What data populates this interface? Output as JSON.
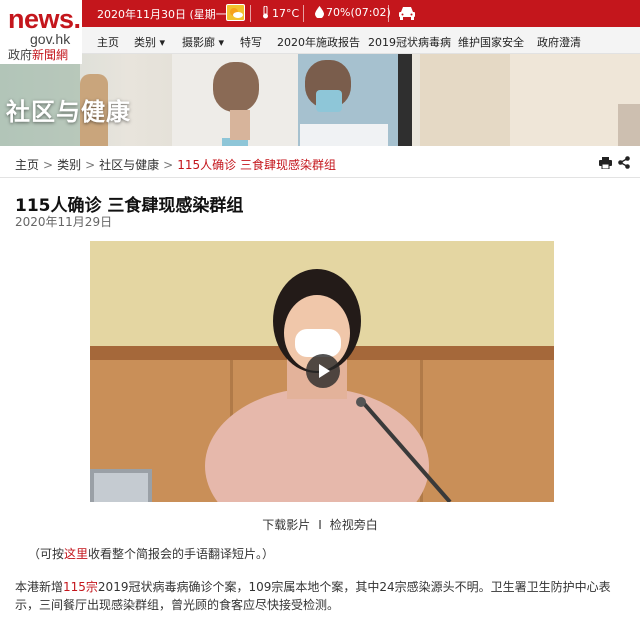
{
  "site": {
    "logo_main": "news.",
    "logo_domain": "gov.hk",
    "logo_cn_a": "政府",
    "logo_cn_b": "新聞網"
  },
  "topbar": {
    "date": "2020年11月30日 (星期一)",
    "weather_icon": "sun-cloud-icon",
    "temperature": "17°C",
    "humidity": "70%(07:02)",
    "traffic_icon": "car-icon"
  },
  "nav": {
    "items": [
      "主页",
      "类别 ▾",
      "摄影廊 ▾",
      "特写",
      "2020年施政报告",
      "2019冠状病毒病",
      "维护国家安全",
      "政府澄清"
    ]
  },
  "banner": {
    "title": "社区与健康"
  },
  "breadcrumb": {
    "home": "主页",
    "category": "类别",
    "section": "社区与健康",
    "current": "115人确诊 三食肆现感染群组"
  },
  "article": {
    "title": "115人确诊 三食肆现感染群组",
    "date": "2020年11月29日",
    "video_links": {
      "download": "下载影片",
      "separator": "I",
      "audio_description": "检视旁白"
    },
    "sign_language_note": {
      "before": "（可按",
      "link": "这里",
      "after": "收看整个简报会的手语翻译短片。）"
    },
    "body": {
      "part1": "本港新增",
      "highlight": "115宗",
      "part2": "2019冠状病毒病确诊个案，109宗属本地个案，其中24宗感染源头不明。卫生署卫生防护中心表示，三间餐厅出现感染群组，曾光顾的食客应尽快接受检测。"
    }
  },
  "colors": {
    "brand_red": "#c4161c",
    "nav_bg": "#f4f4f4"
  }
}
